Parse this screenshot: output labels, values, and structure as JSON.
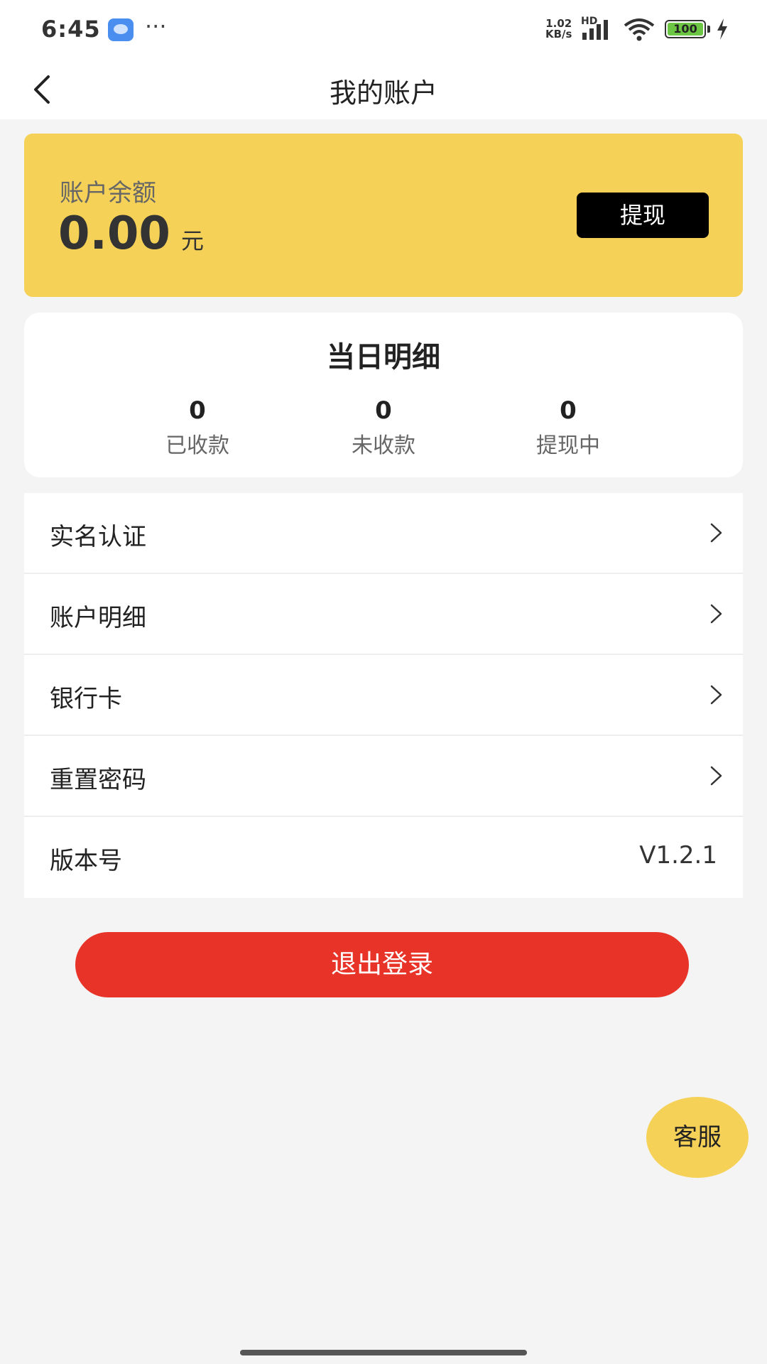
{
  "status_bar": {
    "time": "6:45",
    "more": "···",
    "net_speed_value": "1.02",
    "net_speed_unit": "KB/s",
    "network_type": "HD",
    "battery": "100"
  },
  "nav": {
    "title": "我的账户"
  },
  "balance": {
    "label": "账户余额",
    "amount": "0.00",
    "unit": "元",
    "withdraw_label": "提现"
  },
  "daily": {
    "title": "当日明细",
    "stats": [
      {
        "value": "0",
        "label": "已收款"
      },
      {
        "value": "0",
        "label": "未收款"
      },
      {
        "value": "0",
        "label": "提现中"
      }
    ]
  },
  "menu": {
    "items": [
      {
        "label": "实名认证"
      },
      {
        "label": "账户明细"
      },
      {
        "label": "银行卡"
      },
      {
        "label": "重置密码"
      }
    ],
    "version_label": "版本号",
    "version_value": "V1.2.1"
  },
  "logout_label": "退出登录",
  "service_label": "客服",
  "colors": {
    "accent_yellow": "#f5d257",
    "logout_red": "#e83428",
    "button_black": "#000000",
    "page_bg": "#f4f4f4"
  },
  "icons": [
    "back-arrow-icon",
    "chevron-right-icon",
    "signal-icon",
    "wifi-icon",
    "battery-icon",
    "charging-icon",
    "app-icon"
  ]
}
